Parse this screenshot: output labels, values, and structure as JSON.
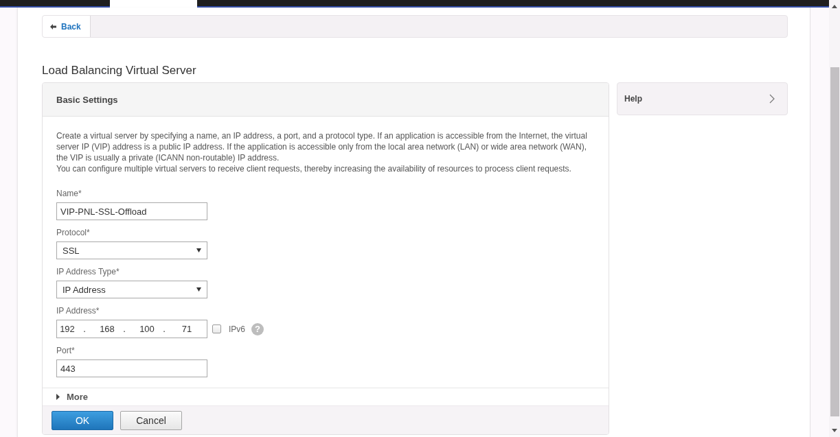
{
  "back_button": {
    "label": "Back"
  },
  "page_title": "Load Balancing Virtual Server",
  "panel": {
    "title": "Basic Settings",
    "description": [
      "Create a virtual server by specifying a name, an IP address, a port, and a protocol type. If an application is accessible from the Internet, the virtual server IP (VIP) address is a public IP address. If the application is accessible only from the local area network (LAN) or wide area network (WAN), the VIP is usually a private (ICANN non-routable) IP address.",
      "You can configure multiple virtual servers to receive client requests, thereby increasing the availability of resources to process client requests."
    ],
    "fields": [
      {
        "kind": "text",
        "label": "Name*",
        "value": "VIP-PNL-SSL-Offload"
      },
      {
        "kind": "select",
        "label": "Protocol*",
        "value": "SSL"
      },
      {
        "kind": "select",
        "label": "IP Address Type*",
        "value": "IP Address"
      },
      {
        "kind": "ip",
        "label": "IP Address*",
        "octets": [
          "192",
          "168",
          "100",
          "71"
        ],
        "separators": [
          ".",
          ".",
          "."
        ],
        "checkbox": {
          "label": "IPv6",
          "checked": false
        },
        "hint": "?"
      },
      {
        "kind": "text",
        "label": "Port*",
        "value": "443"
      }
    ],
    "more": {
      "label": "More",
      "expanded": false
    },
    "buttons": [
      {
        "kind": "primary",
        "label": "OK"
      },
      {
        "kind": "secondary",
        "label": "Cancel"
      }
    ]
  },
  "help_panel": {
    "title": "Help",
    "expanded": false
  }
}
